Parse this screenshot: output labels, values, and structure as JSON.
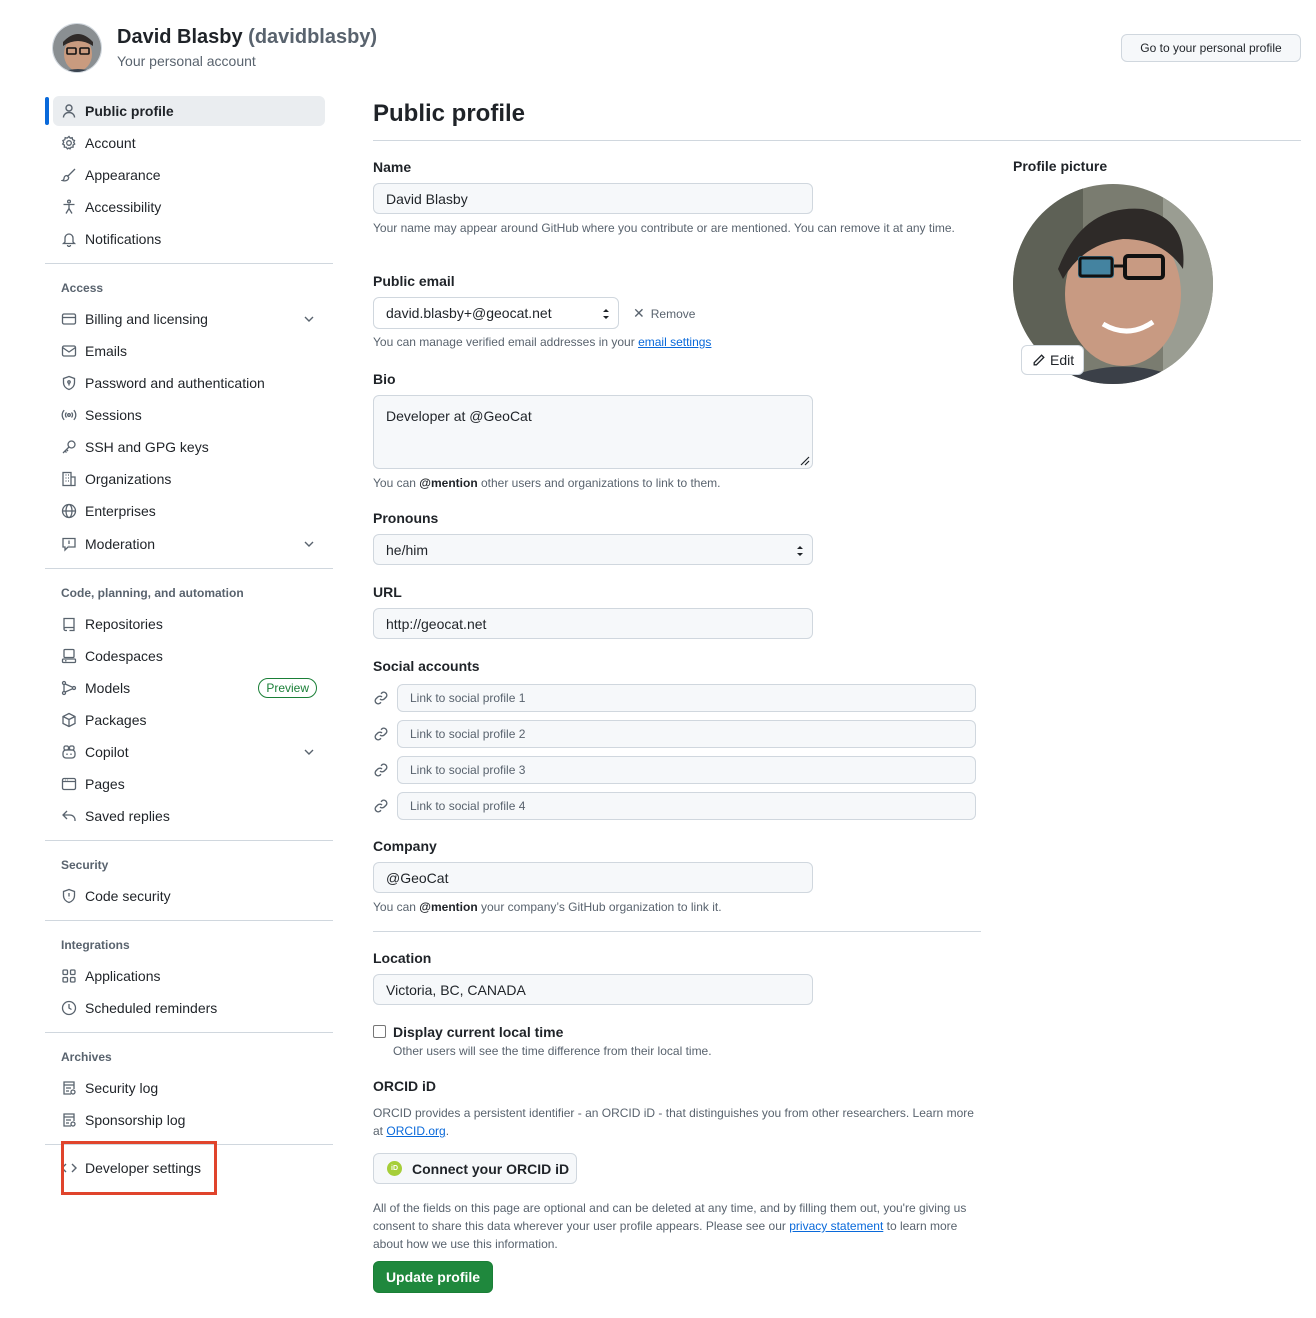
{
  "header": {
    "name": "David Blasby",
    "handle": "(davidblasby)",
    "subtitle": "Your personal account",
    "personal_profile_button": "Go to your personal profile"
  },
  "sidebar": {
    "top_items": [
      {
        "label": "Public profile",
        "icon": "person-icon",
        "active": true
      },
      {
        "label": "Account",
        "icon": "gear-icon"
      },
      {
        "label": "Appearance",
        "icon": "paintbrush-icon"
      },
      {
        "label": "Accessibility",
        "icon": "accessibility-icon"
      },
      {
        "label": "Notifications",
        "icon": "bell-icon"
      }
    ],
    "access_heading": "Access",
    "access_items": [
      {
        "label": "Billing and licensing",
        "icon": "credit-card-icon",
        "expandable": true
      },
      {
        "label": "Emails",
        "icon": "mail-icon"
      },
      {
        "label": "Password and authentication",
        "icon": "shield-lock-icon"
      },
      {
        "label": "Sessions",
        "icon": "broadcast-icon"
      },
      {
        "label": "SSH and GPG keys",
        "icon": "key-icon"
      },
      {
        "label": "Organizations",
        "icon": "organization-icon"
      },
      {
        "label": "Enterprises",
        "icon": "globe-icon"
      },
      {
        "label": "Moderation",
        "icon": "report-icon",
        "expandable": true
      }
    ],
    "code_heading": "Code, planning, and automation",
    "code_items": [
      {
        "label": "Repositories",
        "icon": "repo-icon"
      },
      {
        "label": "Codespaces",
        "icon": "codespaces-icon"
      },
      {
        "label": "Models",
        "icon": "models-icon",
        "badge": "Preview"
      },
      {
        "label": "Packages",
        "icon": "package-icon"
      },
      {
        "label": "Copilot",
        "icon": "copilot-icon",
        "expandable": true
      },
      {
        "label": "Pages",
        "icon": "browser-icon"
      },
      {
        "label": "Saved replies",
        "icon": "reply-icon"
      }
    ],
    "security_heading": "Security",
    "security_items": [
      {
        "label": "Code security",
        "icon": "shield-icon"
      }
    ],
    "integrations_heading": "Integrations",
    "integrations_items": [
      {
        "label": "Applications",
        "icon": "apps-icon"
      },
      {
        "label": "Scheduled reminders",
        "icon": "clock-icon"
      }
    ],
    "archives_heading": "Archives",
    "archives_items": [
      {
        "label": "Security log",
        "icon": "log-icon"
      },
      {
        "label": "Sponsorship log",
        "icon": "log-icon"
      }
    ],
    "developer_settings": "Developer settings"
  },
  "main": {
    "title": "Public profile",
    "name_label": "Name",
    "name_value": "David Blasby",
    "name_note": "Your name may appear around GitHub where you contribute or are mentioned. You can remove it at any time.",
    "email_label": "Public email",
    "email_value": "david.blasby+@geocat.net",
    "email_remove": "Remove",
    "email_note_prefix": "You can manage verified email addresses in your",
    "email_note_link": "email settings",
    "bio_label": "Bio",
    "bio_value": "Developer at @GeoCat",
    "bio_note_prefix": "You can",
    "bio_note_mention": "@mention",
    "bio_note_suffix": "other users and organizations to link to them.",
    "pronouns_label": "Pronouns",
    "pronouns_value": "he/him",
    "url_label": "URL",
    "url_value": "http://geocat.net",
    "social_label": "Social accounts",
    "social_placeholders": [
      "Link to social profile 1",
      "Link to social profile 2",
      "Link to social profile 3",
      "Link to social profile 4"
    ],
    "company_label": "Company",
    "company_value": "@GeoCat",
    "company_note_prefix": "You can",
    "company_note_mention": "@mention",
    "company_note_suffix": "your company’s GitHub organization to link it.",
    "location_label": "Location",
    "location_value": "Victoria, BC, CANADA",
    "local_time_label": "Display current local time",
    "local_time_note": "Other users will see the time difference from their local time.",
    "orcid_label": "ORCID iD",
    "orcid_note_prefix": "ORCID provides a persistent identifier - an ORCID iD - that distinguishes you from other researchers. Learn more at",
    "orcid_note_link": "ORCID.org",
    "orcid_button": "Connect your ORCID iD",
    "consent_prefix": "All of the fields on this page are optional and can be deleted at any time, and by filling them out, you're giving us consent to share this data wherever your user profile appears. Please see our",
    "consent_link": "privacy statement",
    "consent_suffix": "to learn more about how we use this information.",
    "update_button": "Update profile"
  },
  "profile_picture": {
    "label": "Profile picture",
    "edit_button": "Edit"
  },
  "colors": {
    "accent": "#0969da",
    "primary_button": "#1f883d",
    "highlight_box": "#e0442c",
    "preview_badge": "#1a7f37"
  }
}
